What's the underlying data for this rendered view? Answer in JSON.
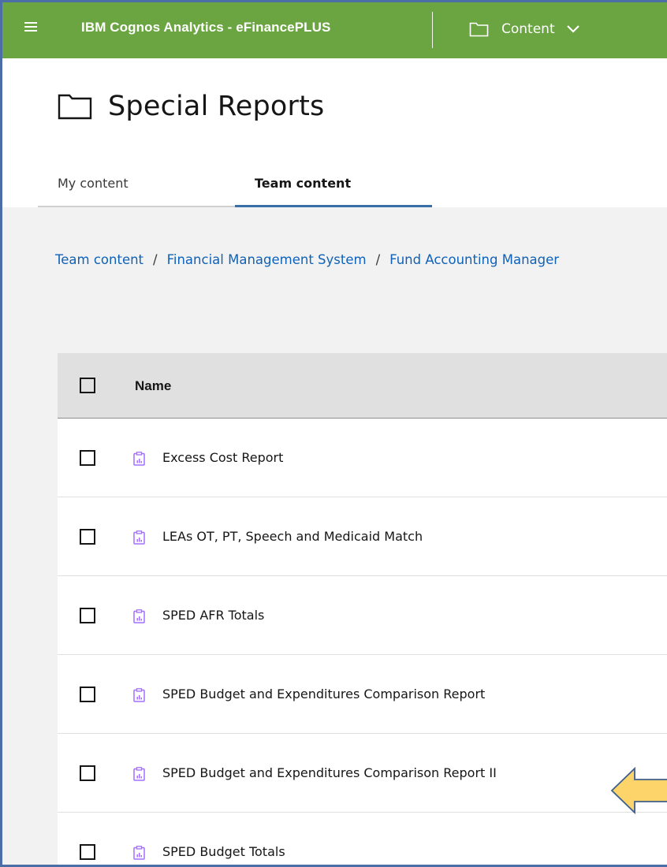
{
  "app": {
    "title": "IBM Cognos Analytics - eFinancePLUS",
    "menu_icon": "hamburger-icon",
    "switcher": {
      "icon": "folder-icon",
      "label": "Content",
      "chevron": "chevron-down-icon"
    },
    "brand_color": "#6aa541"
  },
  "page": {
    "icon": "folder-icon",
    "title": "Special Reports"
  },
  "tabs": [
    {
      "label": "My content",
      "active": false
    },
    {
      "label": "Team content",
      "active": true
    }
  ],
  "breadcrumb": [
    "Team content",
    "Financial Management System",
    "Fund Accounting Manager"
  ],
  "table": {
    "header": {
      "name": "Name"
    },
    "rows": [
      {
        "name": "Excess Cost Report",
        "icon": "report-icon"
      },
      {
        "name": "LEAs OT, PT, Speech and Medicaid Match",
        "icon": "report-icon"
      },
      {
        "name": "SPED AFR Totals",
        "icon": "report-icon"
      },
      {
        "name": "SPED Budget and Expenditures Comparison Report",
        "icon": "report-icon"
      },
      {
        "name": "SPED Budget and Expenditures Comparison Report II",
        "icon": "report-icon"
      },
      {
        "name": "SPED Budget Totals",
        "icon": "report-icon"
      }
    ]
  },
  "annotation": {
    "icon": "arrow-left-icon",
    "color": "#fcd46a"
  }
}
